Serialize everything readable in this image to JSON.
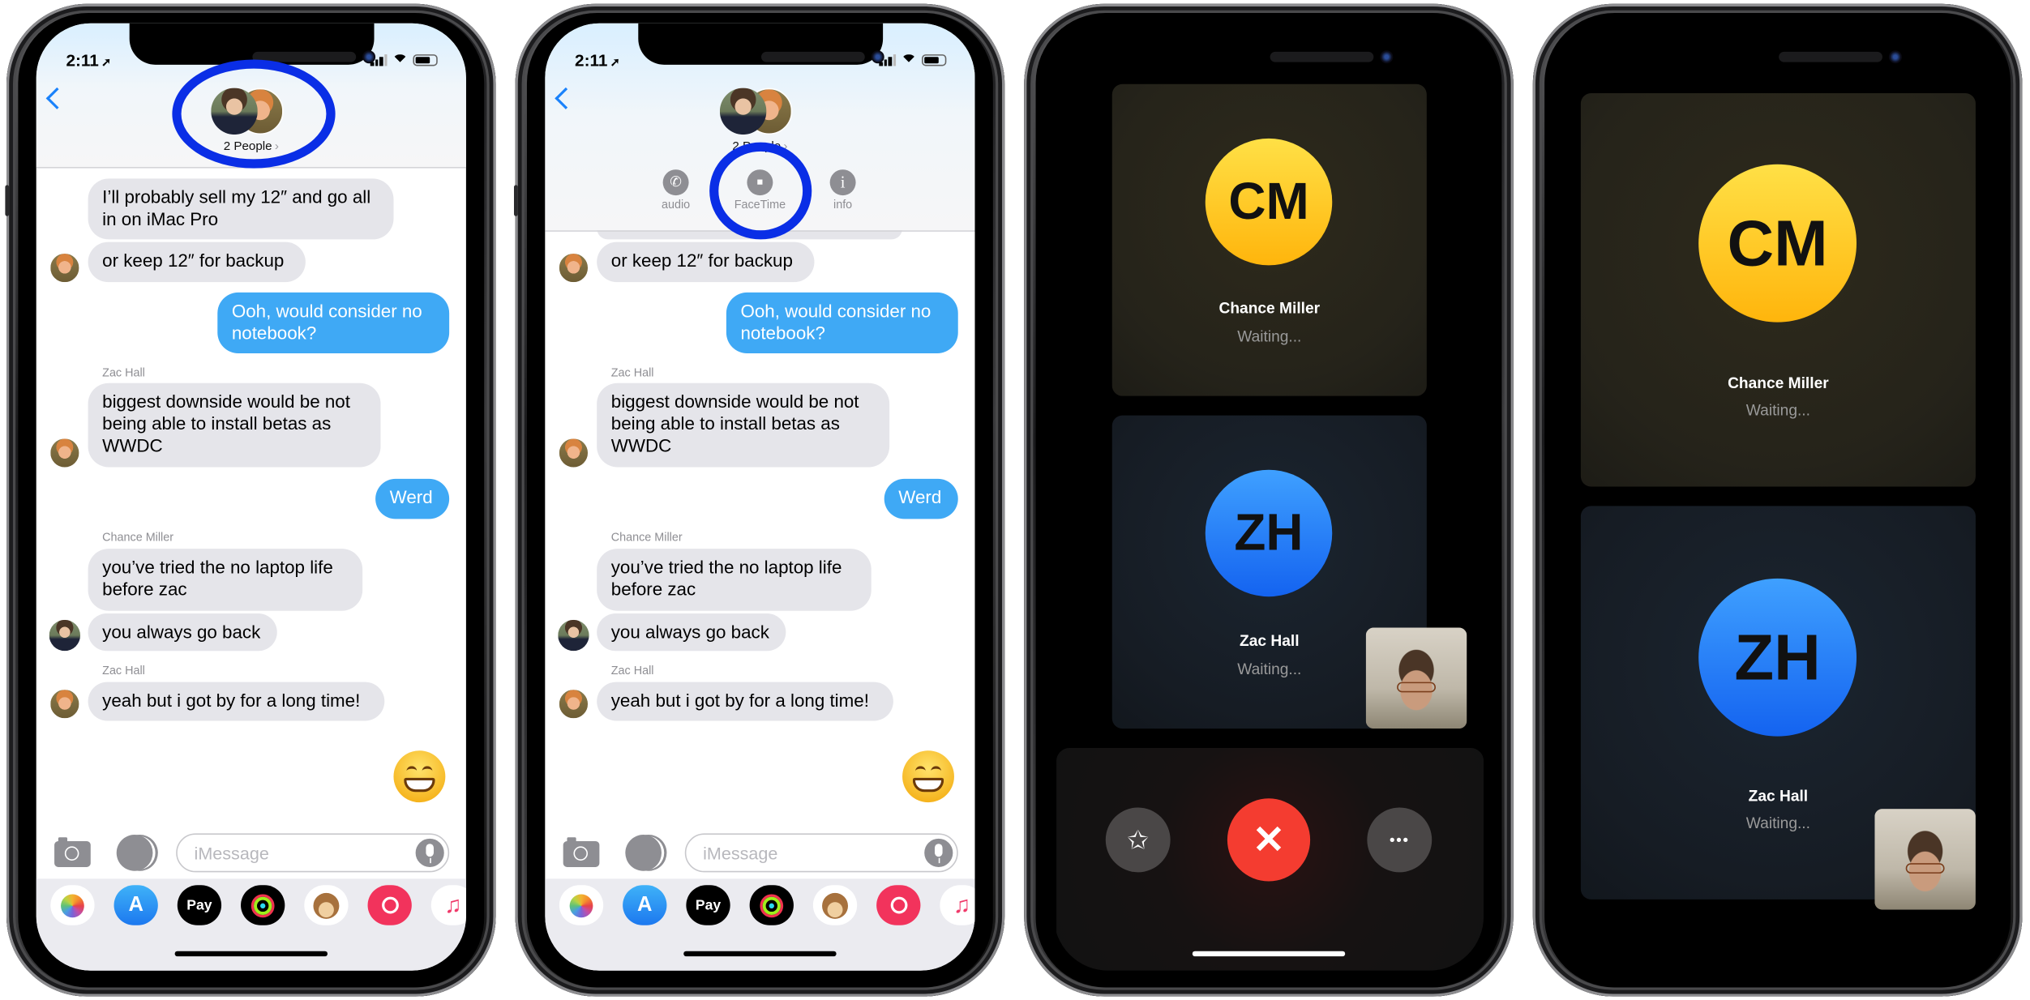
{
  "colors": {
    "imessage_blue": "#3fa9f5",
    "received_gray": "#e5e5ea",
    "annotation_blue": "#0a2ee6",
    "end_call_red": "#f43c30",
    "cm_yellow": "#ffc21a",
    "zh_blue": "#2a86ff"
  },
  "phones": [
    {
      "status": {
        "time": "2:11",
        "location_icon": "location-arrow-icon"
      },
      "header": {
        "group_label": "2 People",
        "chevron": "›"
      },
      "messages": [
        {
          "text": "I’ll probably sell my 12″ and go all\nin on iMac Pro"
        },
        {
          "text": "or keep 12″ for backup"
        },
        {
          "text": "Ooh, would consider no\nnotebook?"
        },
        {
          "sender": "Zac Hall",
          "text": "biggest downside would be not\nbeing able to install betas as\nWWDC"
        },
        {
          "text": "Werd"
        },
        {
          "sender": "Chance Miller",
          "text": "you’ve tried the no laptop life\nbefore zac"
        },
        {
          "text": "you always go back"
        },
        {
          "sender": "Zac Hall",
          "text": "yeah but i got by for a long time!"
        }
      ],
      "emoji": "grinning-face",
      "composer": {
        "placeholder": "iMessage"
      },
      "apps": [
        {
          "name": "Photos"
        },
        {
          "name": "App Store",
          "glyph": "A"
        },
        {
          "name": "Apple Pay",
          "glyph": " Pay"
        },
        {
          "name": "Activity"
        },
        {
          "name": "Animoji"
        },
        {
          "name": "Images"
        },
        {
          "name": "Music",
          "glyph": "♫"
        }
      ]
    },
    {
      "status": {
        "time": "2:11"
      },
      "header": {
        "group_label": "2 People",
        "chevron": "›"
      },
      "actions": [
        {
          "label": "audio",
          "glyph": "✆"
        },
        {
          "label": "FaceTime",
          "glyph": "■"
        },
        {
          "label": "info",
          "glyph": "i"
        }
      ],
      "messages": [
        {
          "text": "or keep 12″ for backup"
        },
        {
          "text": "Ooh, would consider no\nnotebook?"
        },
        {
          "sender": "Zac Hall",
          "text": "biggest downside would be not\nbeing able to install betas as\nWWDC"
        },
        {
          "text": "Werd"
        },
        {
          "sender": "Chance Miller",
          "text": "you’ve tried the no laptop life\nbefore zac"
        },
        {
          "text": "you always go back"
        },
        {
          "sender": "Zac Hall",
          "text": "yeah but i got by for a long time!"
        }
      ],
      "composer": {
        "placeholder": "iMessage"
      },
      "apps": [
        {
          "name": "Photos"
        },
        {
          "name": "App Store",
          "glyph": "A"
        },
        {
          "name": "Apple Pay",
          "glyph": " Pay"
        },
        {
          "name": "Activity"
        },
        {
          "name": "Animoji"
        },
        {
          "name": "Images"
        },
        {
          "name": "Music",
          "glyph": "♫"
        }
      ]
    },
    {
      "participants": [
        {
          "initials": "CM",
          "name": "Chance Miller",
          "status": "Waiting..."
        },
        {
          "initials": "ZH",
          "name": "Zac Hall",
          "status": "Waiting..."
        }
      ],
      "controls": {
        "effects_glyph": "✩",
        "end_glyph": "✕",
        "more_glyph": "•••"
      }
    },
    {
      "participants": [
        {
          "initials": "CM",
          "name": "Chance Miller",
          "status": "Waiting..."
        },
        {
          "initials": "ZH",
          "name": "Zac Hall",
          "status": "Waiting..."
        }
      ]
    }
  ]
}
